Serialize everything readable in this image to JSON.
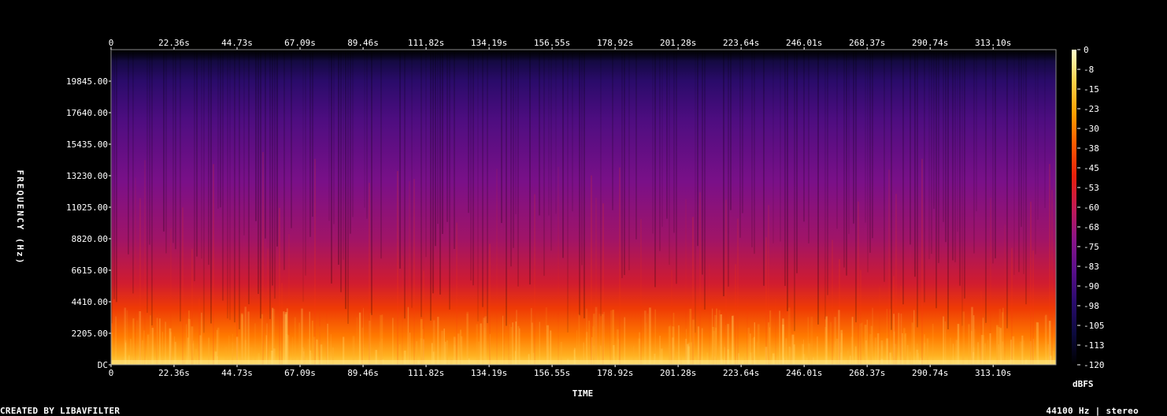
{
  "chart_data": {
    "type": "heatmap",
    "xlabel": "TIME",
    "ylabel": "FREQUENCY (Hz)",
    "x_ticks": [
      "0",
      "22.36s",
      "44.73s",
      "67.09s",
      "89.46s",
      "111.82s",
      "134.19s",
      "156.55s",
      "178.92s",
      "201.28s",
      "223.64s",
      "246.01s",
      "268.37s",
      "290.74s",
      "313.10s"
    ],
    "x_tick_values": [
      0,
      22.36,
      44.73,
      67.09,
      89.46,
      111.82,
      134.19,
      156.55,
      178.92,
      201.28,
      223.64,
      246.01,
      268.37,
      290.74,
      313.1
    ],
    "xlim": [
      0,
      335.4
    ],
    "y_ticks": [
      "DC",
      "2205.00",
      "4410.00",
      "6615.00",
      "8820.00",
      "11025.00",
      "13230.00",
      "15435.00",
      "17640.00",
      "19845.00"
    ],
    "y_tick_values": [
      0,
      2205,
      4410,
      6615,
      8820,
      11025,
      13230,
      15435,
      17640,
      19845
    ],
    "ylim": [
      0,
      22050
    ],
    "colorbar": {
      "label": "dBFS",
      "ticks": [
        "0",
        "-8",
        "-15",
        "-23",
        "-30",
        "-38",
        "-45",
        "-53",
        "-60",
        "-68",
        "-75",
        "-83",
        "-90",
        "-98",
        "-105",
        "-113",
        "-120"
      ],
      "range": [
        -120,
        0
      ],
      "colors": [
        "#000000",
        "#0c0a3e",
        "#2a0b6e",
        "#5a0f8a",
        "#8a1488",
        "#c41a52",
        "#e8200a",
        "#ff5a00",
        "#ffa000",
        "#ffd24a",
        "#ffffcc"
      ]
    }
  },
  "footer": {
    "left": "CREATED BY LIBAVFILTER",
    "right": "44100 Hz | stereo"
  }
}
